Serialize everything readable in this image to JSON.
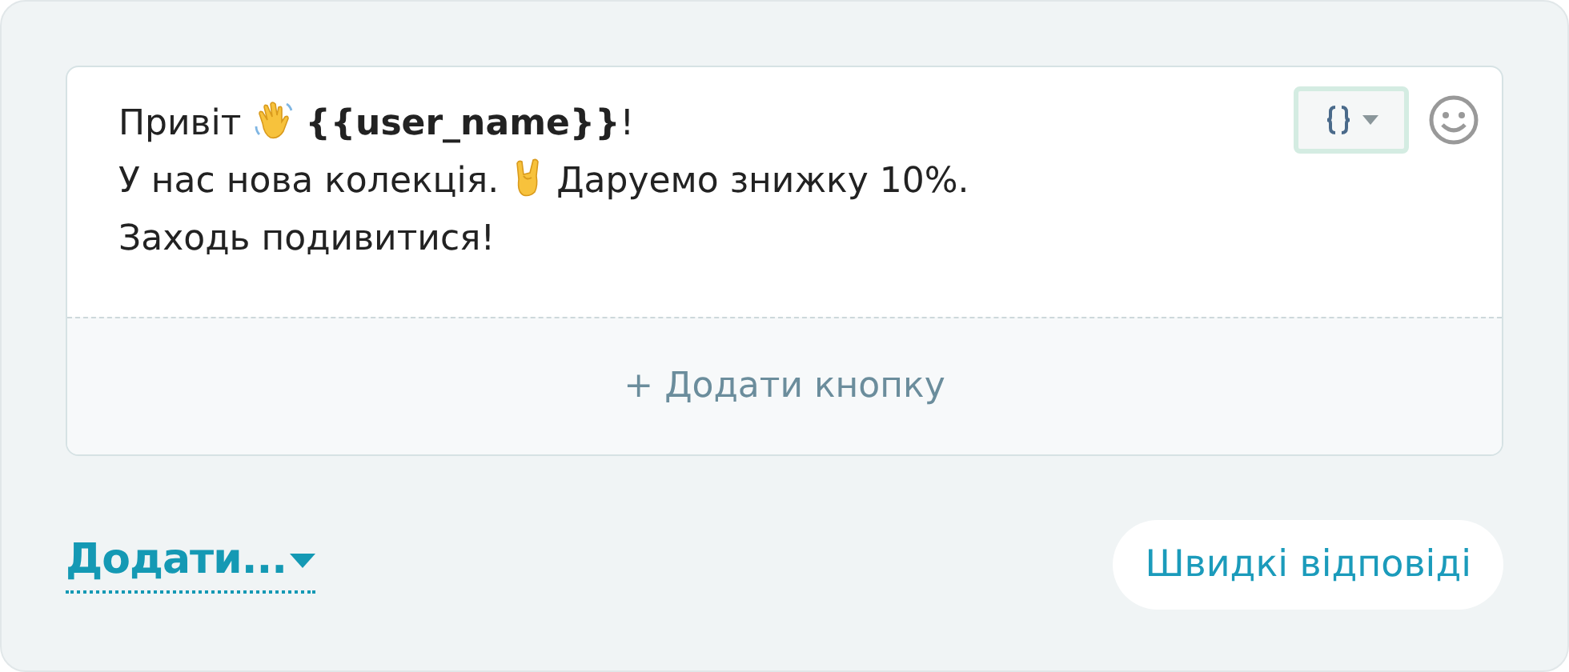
{
  "message": {
    "lines": [
      [
        {
          "kind": "text",
          "text": "Привіт"
        },
        {
          "kind": "wave"
        },
        {
          "kind": "text",
          "text": "**{{user_name}}**!"
        }
      ],
      [
        {
          "kind": "text",
          "text": "У нас нова колекція."
        },
        {
          "kind": "rock"
        },
        {
          "kind": "text",
          "text": "Даруемо знижку 10%."
        }
      ],
      [
        {
          "kind": "text",
          "text": "Заходь подивитися!"
        }
      ]
    ]
  },
  "add_button": {
    "label": "+ Додати кнопку"
  },
  "add_menu": {
    "label": "Додати..."
  },
  "quick_replies": {
    "label": "Швидкі відповіді"
  }
}
